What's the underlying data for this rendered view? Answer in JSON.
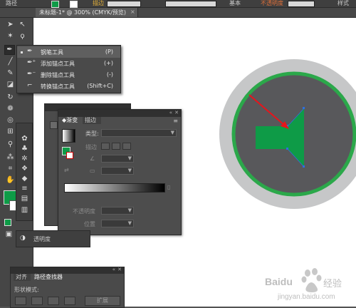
{
  "control_bar": {
    "left_label": "路径",
    "weight_label": "描边",
    "base_label": "基本",
    "opacity_label": "不透明度",
    "style_label": "样式",
    "colors": {
      "fill": "#0e9b47",
      "stroke": "#ffffff"
    }
  },
  "document_tab": {
    "title": "未标题-1* @ 300% (CMYK/预览)",
    "close": "×"
  },
  "pen_flyout": {
    "items": [
      {
        "label": "钢笔工具",
        "shortcut": "(P)",
        "icon": "pen-icon",
        "selected": true
      },
      {
        "label": "添加锚点工具",
        "shortcut": "(+)",
        "icon": "add-anchor-icon"
      },
      {
        "label": "删除锚点工具",
        "shortcut": "(-)",
        "icon": "delete-anchor-icon"
      },
      {
        "label": "转换锚点工具",
        "shortcut": "(Shift+C)",
        "icon": "convert-anchor-icon"
      }
    ]
  },
  "gradient_panel": {
    "tabs": [
      "渐变",
      "描边"
    ],
    "type_label": "类型:",
    "stroke_label": "描边",
    "opacity_label": "不透明度",
    "location_label": "位置",
    "colors": {
      "fill_swatch": "#0e9b47"
    }
  },
  "transparency_tab": {
    "label": "透明度"
  },
  "pathfinder_panel": {
    "tabs": [
      "对齐",
      "路径查找器"
    ],
    "shape_modes_label": "形状模式:",
    "expand_label": "扩展"
  },
  "artwork": {
    "outer_circle_color": "#c6c7c8",
    "ring_color": "#2ba84a",
    "inner_circle_color": "#58585b",
    "speaker_color": "#0e9b47",
    "arrow_color": "#e8141b",
    "anchor_color": "#2f6fe0"
  },
  "watermark": {
    "brand": "Baidu",
    "brand_cn": "经验",
    "url": "jingyan.baidu.com"
  }
}
